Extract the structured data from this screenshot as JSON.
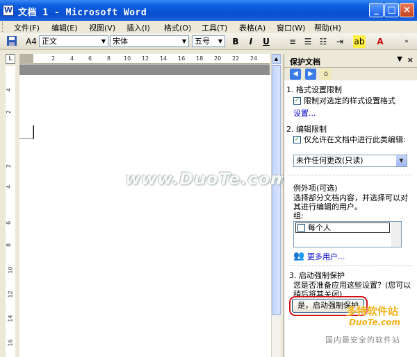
{
  "window": {
    "title": "文档 1 - Microsoft Word",
    "app_icon": "W"
  },
  "menu": [
    "文件(F)",
    "编辑(E)",
    "视图(V)",
    "插入(I)",
    "格式(O)",
    "工具(T)",
    "表格(A)",
    "窗口(W)",
    "帮助(H)"
  ],
  "toolbar": {
    "style_value": "正文",
    "style_icon": "A4",
    "font_value": "宋体",
    "size_value": "五号",
    "bold": "B",
    "italic": "I",
    "underline": "U"
  },
  "ruler": {
    "corner": "L",
    "ticks": [
      "2",
      "4",
      "6",
      "8",
      "10",
      "12",
      "14",
      "16",
      "18",
      "20",
      "22",
      "24"
    ],
    "vticks": [
      "4",
      "2",
      "2",
      "4",
      "6",
      "8",
      "10",
      "12",
      "14",
      "16"
    ]
  },
  "task_pane": {
    "title": "保护文档",
    "section1": {
      "title": "1. 格式设置限制",
      "checkbox_label": "限制对选定的样式设置格式",
      "settings_link": "设置..."
    },
    "section2": {
      "title": "2. 编辑限制",
      "checkbox_label": "仅允许在文档中进行此类编辑:",
      "dropdown_value": "未作任何更改(只读)"
    },
    "exceptions": {
      "title": "例外项(可选)",
      "description": "选择部分文档内容，并选择可以对其进行编辑的用户。",
      "group_label": "组:",
      "group_entry": "每个人",
      "more_users": "更多用户..."
    },
    "section3": {
      "title": "3. 启动强制保护",
      "description": "您是否准备应用这些设置？(您可以稍后将其关闭)",
      "button": "是，启动强制保护"
    }
  },
  "watermark": {
    "text": "www.DuoTe.com",
    "site_cn": "多特软件站",
    "site_en": "DuoTe.com",
    "slogan": "国内最安全的软件站"
  },
  "colors": {
    "titlebar": "#0a4fd0",
    "highlight_ring": "#d30f0f",
    "link": "#0000cc"
  }
}
